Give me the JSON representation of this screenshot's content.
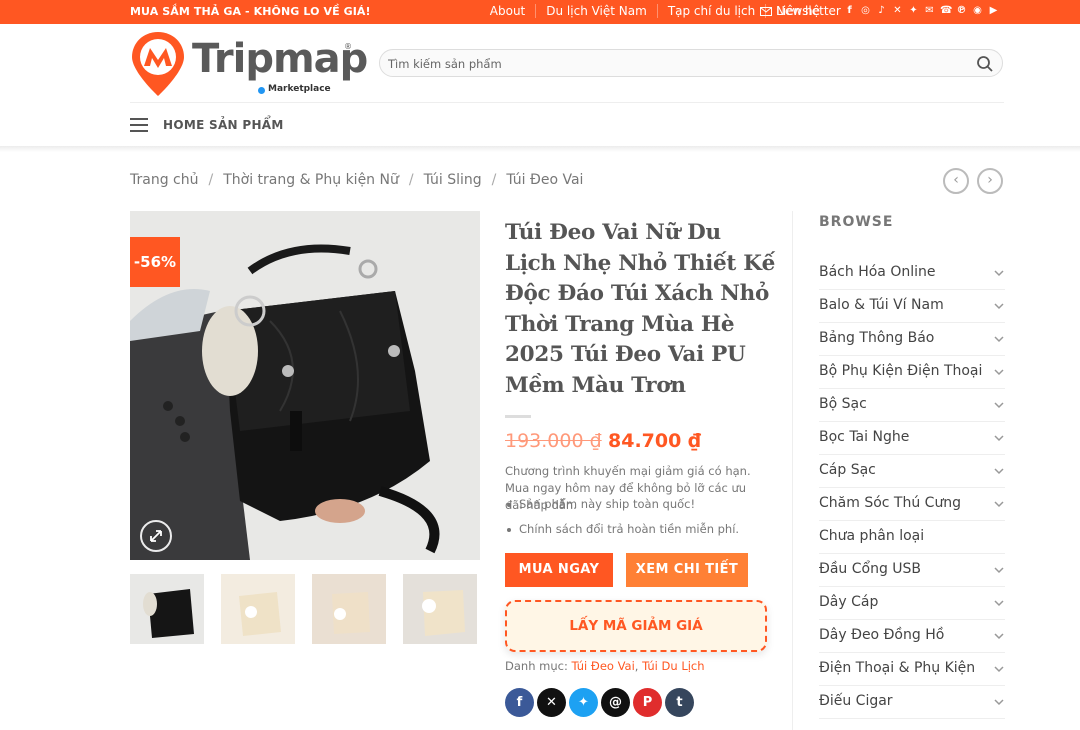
{
  "topbar": {
    "promo": "MUA SẮM THẢ GA - KHÔNG LO VỀ GIÁ!",
    "links": [
      "About",
      "Du lịch Việt Nam",
      "Tạp chí du lịch",
      "Liên hệ"
    ],
    "newsletter": "Newsletter",
    "social_icons": [
      "facebook-icon",
      "instagram-icon",
      "tiktok-icon",
      "x-icon",
      "twitter-icon",
      "email-icon",
      "phone-icon",
      "pinterest-icon",
      "rss-icon",
      "youtube-icon"
    ]
  },
  "header": {
    "logo_text": "Tripmap",
    "logo_reg": "®",
    "logo_sub": "Marketplace",
    "search_placeholder": "Tìm kiếm sản phẩm"
  },
  "nav": {
    "items": [
      "HOME",
      "SẢN PHẨM"
    ]
  },
  "breadcrumb": [
    "Trang chủ",
    "Thời trang & Phụ kiện Nữ",
    "Túi Sling",
    "Túi Đeo Vai"
  ],
  "product": {
    "badge": "-56%",
    "title": "Túi Đeo Vai Nữ Du Lịch Nhẹ Nhỏ Thiết Kế Độc Đáo Túi Xách Nhỏ Thời Trang Mùa Hè 2025 Túi Đeo Vai PU Mềm Màu Trơn",
    "old_price": "193.000 ₫",
    "new_price": "84.700 ₫",
    "description": "Chương trình khuyến mại giảm giá có hạn. Mua ngay hôm nay để không bỏ lỡ các ưu đãi hấp dẫn.",
    "bullets": [
      "Sản phẩm này ship toàn quốc!",
      "Chính sách đổi trả hoàn tiền miễn phí."
    ],
    "buy_label": "MUA NGAY",
    "detail_label": "XEM CHI TIẾT",
    "coupon_label": "LẤY MÃ GIẢM GIÁ",
    "category_label": "Danh mục:",
    "categories": [
      "Túi Đeo Vai",
      "Túi Du Lịch"
    ],
    "share": [
      "facebook",
      "x",
      "twitter",
      "threads",
      "pinterest",
      "tumblr"
    ]
  },
  "sidebar": {
    "heading": "BROWSE",
    "categories": [
      {
        "label": "Bách Hóa Online",
        "expandable": true
      },
      {
        "label": "Balo & Túi Ví Nam",
        "expandable": true
      },
      {
        "label": "Bảng Thông Báo",
        "expandable": true
      },
      {
        "label": "Bộ Phụ Kiện Điện Thoại",
        "expandable": true
      },
      {
        "label": "Bộ Sạc",
        "expandable": true
      },
      {
        "label": "Bọc Tai Nghe",
        "expandable": true
      },
      {
        "label": "Cáp Sạc",
        "expandable": true
      },
      {
        "label": "Chăm Sóc Thú Cưng",
        "expandable": true
      },
      {
        "label": "Chưa phân loại",
        "expandable": false
      },
      {
        "label": "Đầu Cổng USB",
        "expandable": true
      },
      {
        "label": "Dây Cáp",
        "expandable": true
      },
      {
        "label": "Dây Đeo Đồng Hồ",
        "expandable": true
      },
      {
        "label": "Điện Thoại & Phụ Kiện",
        "expandable": true
      },
      {
        "label": "Điếu Cigar",
        "expandable": true
      }
    ]
  },
  "colors": {
    "accent": "#ff5722",
    "accent2": "#ff8035"
  }
}
